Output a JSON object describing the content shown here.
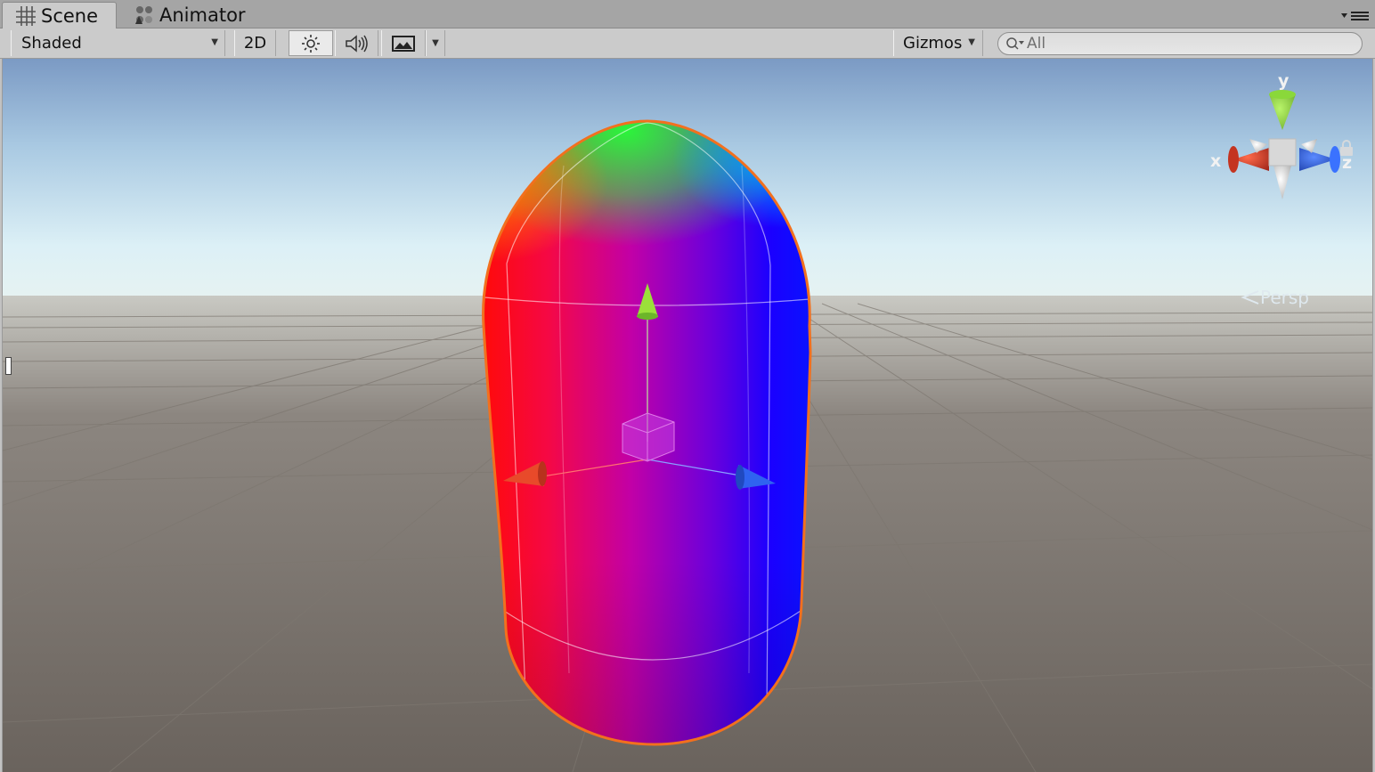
{
  "tabs": [
    {
      "label": "Scene",
      "icon": "grid-icon",
      "active": true
    },
    {
      "label": "Animator",
      "icon": "animator-icon",
      "active": false
    }
  ],
  "toolbar": {
    "draw_mode": "Shaded",
    "mode_2d": "2D",
    "lighting_icon": "sun-icon",
    "audio_icon": "speaker-icon",
    "effects_icon": "image-icon",
    "gizmos_label": "Gizmos",
    "search_placeholder": "All"
  },
  "scene_gizmo": {
    "axis_y": "y",
    "axis_x": "x",
    "axis_z": "z",
    "projection": "Persp",
    "lock_icon": "lock-icon"
  },
  "colors": {
    "selection_outline": "#f2701e",
    "axis_x": "#e8452b",
    "axis_y": "#8ee034",
    "axis_z": "#3166f0",
    "ground": "#6a635d",
    "sky_top": "#7e9dc7"
  }
}
